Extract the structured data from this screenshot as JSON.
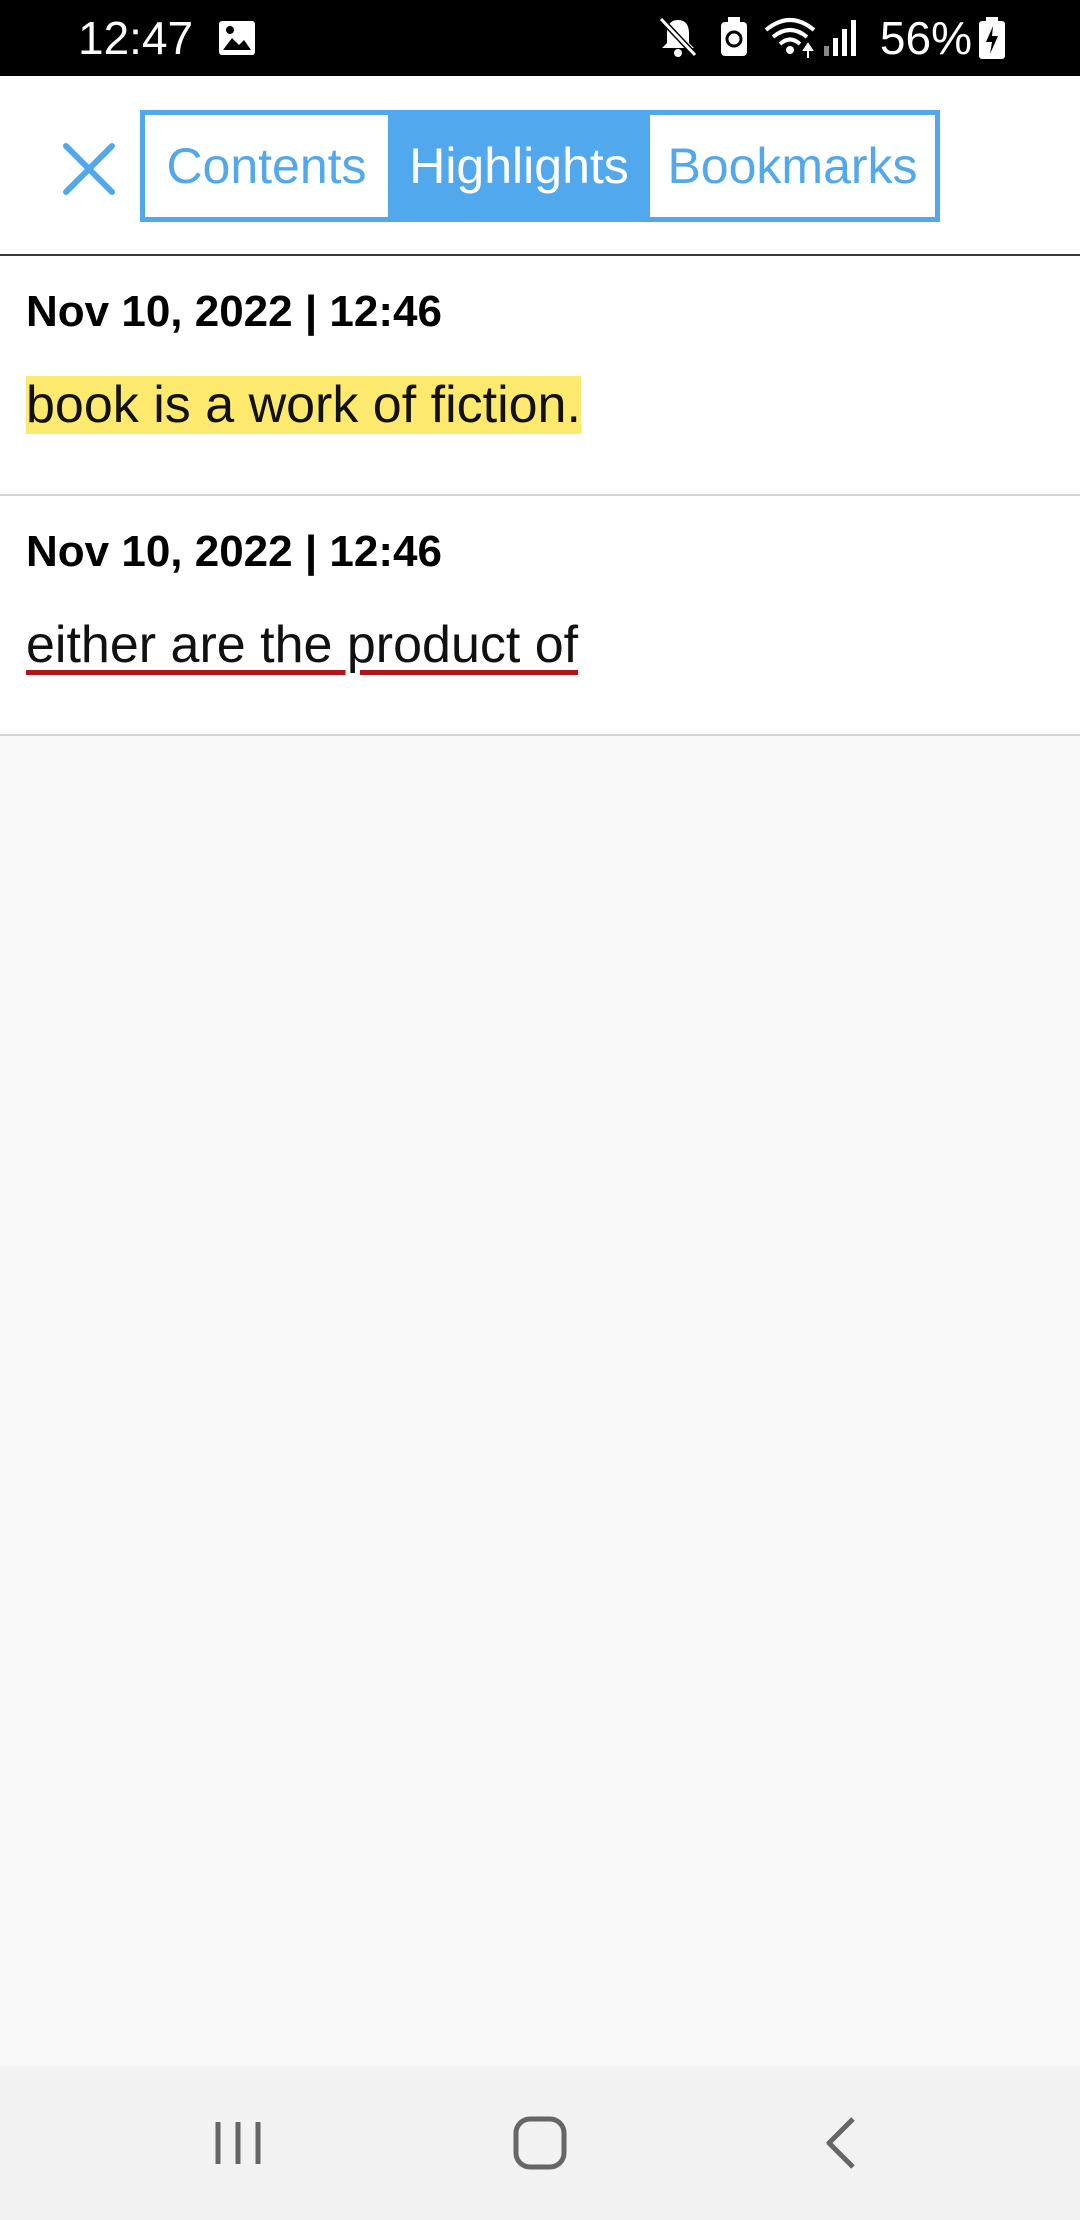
{
  "status_bar": {
    "time": "12:47",
    "battery_percent": "56%",
    "icons": [
      "image-icon",
      "mute-icon",
      "sync-icon",
      "wifi-icon",
      "signal-icon",
      "battery-icon"
    ]
  },
  "header": {
    "close_icon": "close-icon",
    "tabs": [
      {
        "label": "Contents",
        "active": false
      },
      {
        "label": "Highlights",
        "active": true
      },
      {
        "label": "Bookmarks",
        "active": false
      }
    ]
  },
  "highlights": [
    {
      "date": "Nov 10, 2022 | 12:46",
      "text": "book is a work of fiction.",
      "style": "highlight",
      "color": "#fde96e"
    },
    {
      "date": "Nov 10, 2022 | 12:46",
      "text": "either are the product of",
      "style": "underline",
      "color": "#b0151c"
    }
  ],
  "nav_bar": {
    "buttons": [
      "recent-apps-icon",
      "home-icon",
      "back-icon"
    ]
  },
  "colors": {
    "accent": "#52a8ec",
    "highlight_yellow": "#fde96e",
    "underline_red": "#b0151c"
  }
}
